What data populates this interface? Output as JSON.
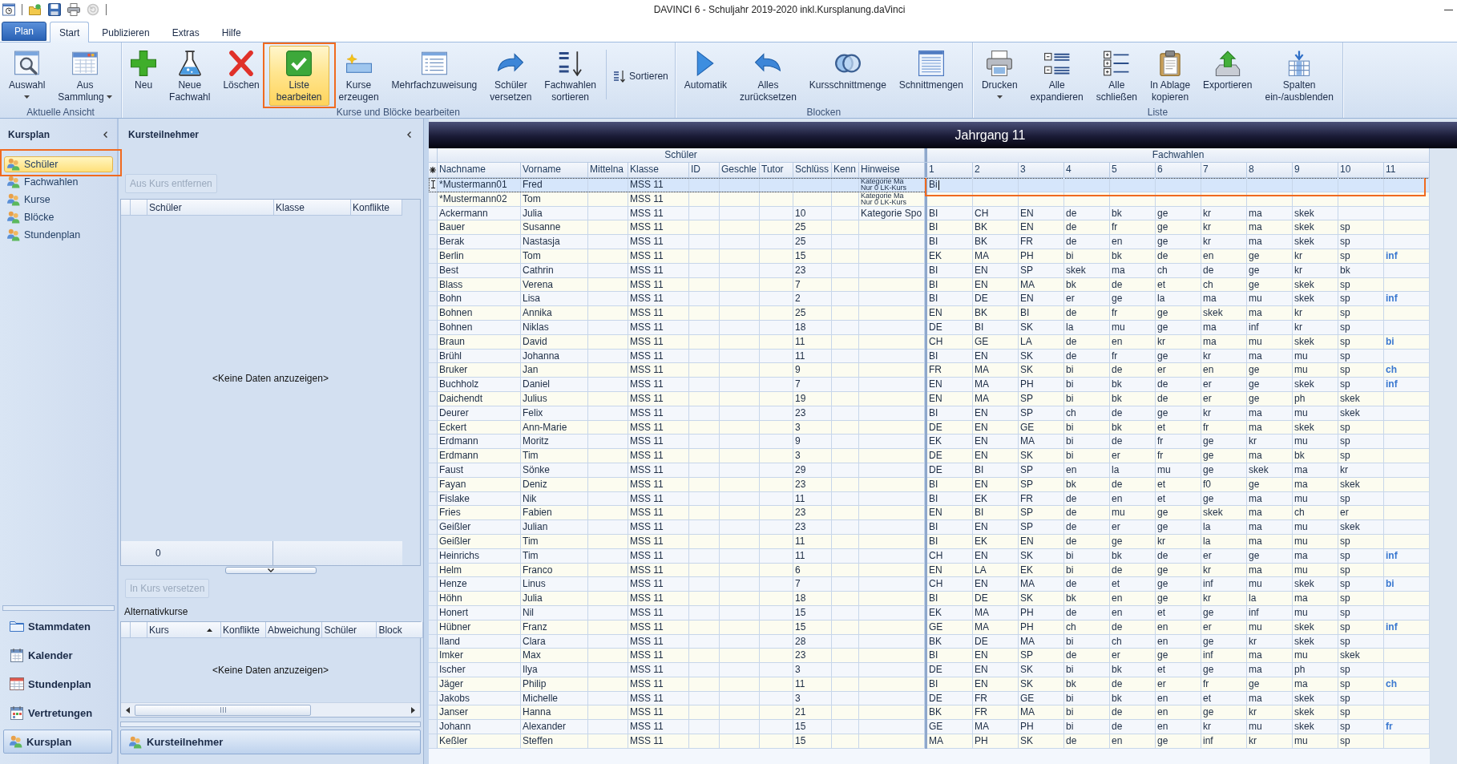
{
  "window": {
    "title": "DAVINCI 6 - Schuljahr 2019-2020 inkl.Kursplanung.daVinci"
  },
  "ribbon": {
    "file_tab": "Plan",
    "tabs": [
      {
        "label": "Start",
        "selected": true
      },
      {
        "label": "Publizieren",
        "selected": false
      },
      {
        "label": "Extras",
        "selected": false
      },
      {
        "label": "Hilfe",
        "selected": false
      }
    ],
    "groups": [
      {
        "label": "Aktuelle Ansicht",
        "buttons": [
          {
            "kind": "large",
            "lines": [
              "Auswahl"
            ],
            "dropdown": true,
            "selected": false
          },
          {
            "kind": "large",
            "lines": [
              "Aus",
              "Sammlung"
            ],
            "dropdown": true,
            "selected": false
          }
        ]
      },
      {
        "label": "Kurse und Blöcke bearbeiten",
        "buttons": [
          {
            "kind": "large",
            "lines": [
              "Neu"
            ],
            "dropdown": false,
            "selected": false
          },
          {
            "kind": "large",
            "lines": [
              "Neue",
              "Fachwahl"
            ],
            "dropdown": false,
            "selected": false
          },
          {
            "kind": "large",
            "lines": [
              "Löschen"
            ],
            "dropdown": false,
            "selected": false
          },
          {
            "kind": "large",
            "lines": [
              "Liste",
              "bearbeiten"
            ],
            "dropdown": false,
            "selected": true
          },
          {
            "kind": "large",
            "lines": [
              "Kurse",
              "erzeugen"
            ],
            "dropdown": false,
            "selected": false
          },
          {
            "kind": "large",
            "lines": [
              "Mehrfachzuweisung"
            ],
            "dropdown": false,
            "selected": false
          },
          {
            "kind": "large",
            "lines": [
              "Schüler",
              "versetzen"
            ],
            "dropdown": false,
            "selected": false
          },
          {
            "kind": "large",
            "lines": [
              "Fachwahlen",
              "sortieren"
            ],
            "dropdown": false,
            "selected": false
          },
          {
            "kind": "small",
            "lines": [
              "Sortieren"
            ],
            "dropdown": false,
            "selected": false
          }
        ]
      },
      {
        "label": "Blocken",
        "buttons": [
          {
            "kind": "large",
            "lines": [
              "Automatik"
            ],
            "dropdown": false,
            "selected": false
          },
          {
            "kind": "large",
            "lines": [
              "Alles",
              "zurücksetzen"
            ],
            "dropdown": false,
            "selected": false
          },
          {
            "kind": "large",
            "lines": [
              "Kursschnittmenge"
            ],
            "dropdown": false,
            "selected": false
          },
          {
            "kind": "large",
            "lines": [
              "Schnittmengen"
            ],
            "dropdown": false,
            "selected": false
          }
        ]
      },
      {
        "label": "Liste",
        "buttons": [
          {
            "kind": "large",
            "lines": [
              "Drucken"
            ],
            "dropdown": true,
            "selected": false
          },
          {
            "kind": "large",
            "lines": [
              "Alle",
              "expandieren"
            ],
            "dropdown": false,
            "selected": false
          },
          {
            "kind": "large",
            "lines": [
              "Alle",
              "schließen"
            ],
            "dropdown": false,
            "selected": false
          },
          {
            "kind": "large",
            "lines": [
              "In Ablage",
              "kopieren"
            ],
            "dropdown": false,
            "selected": false
          },
          {
            "kind": "large",
            "lines": [
              "Exportieren"
            ],
            "dropdown": false,
            "selected": false
          },
          {
            "kind": "large",
            "lines": [
              "Spalten",
              "ein-/ausblenden"
            ],
            "dropdown": false,
            "selected": false
          }
        ]
      }
    ]
  },
  "sidebar": {
    "title": "Kursplan",
    "items": [
      {
        "label": "Schüler",
        "selected": true
      },
      {
        "label": "Fachwahlen",
        "selected": false
      },
      {
        "label": "Kurse",
        "selected": false
      },
      {
        "label": "Blöcke",
        "selected": false
      },
      {
        "label": "Stundenplan",
        "selected": false
      }
    ],
    "sections": [
      {
        "label": "Stammdaten",
        "selected": false
      },
      {
        "label": "Kalender",
        "selected": false
      },
      {
        "label": "Stundenplan",
        "selected": false
      },
      {
        "label": "Vertretungen",
        "selected": false
      },
      {
        "label": "Kursplan",
        "selected": true
      }
    ]
  },
  "course_participants": {
    "title": "Kursteilnehmer",
    "remove_button": {
      "label": "Aus Kurs entfernen",
      "disabled": true
    },
    "table": {
      "columns": [
        "Schüler",
        "Klasse",
        "Konflikte"
      ],
      "empty_text": "<Keine Daten anzuzeigen>",
      "count": "0"
    },
    "move_button": {
      "label": "In Kurs versetzen",
      "disabled": true
    },
    "alternatives": {
      "title": "Alternativkurse",
      "columns": [
        {
          "label": "Kurs",
          "sorted": true
        },
        {
          "label": "Konflikte",
          "sorted": false
        },
        {
          "label": "Abweichung",
          "sorted": false
        },
        {
          "label": "Schüler",
          "sorted": false
        },
        {
          "label": "Block",
          "sorted": false
        }
      ],
      "empty_text": "<Keine Daten anzuzeigen>"
    },
    "footer_tab": "Kursteilnehmer"
  },
  "grid": {
    "title": "Jahrgang 11",
    "groups": [
      "Schüler",
      "Fachwahlen"
    ],
    "columns": [
      "Nachname",
      "Vorname",
      "Mittelna",
      "Klasse",
      "ID",
      "Geschle",
      "Tutor",
      "Schlüss",
      "Kenn",
      "Hinweise"
    ],
    "choice_columns": [
      "1",
      "2",
      "3",
      "4",
      "5",
      "6",
      "7",
      "8",
      "9",
      "10",
      "11"
    ],
    "rows": [
      {
        "nachname": "*Mustermann01",
        "vorname": "Fred",
        "klasse": "MSS 11",
        "hinweise": [
          "Kategorie Ma",
          "Nur 0 LK-Kurs"
        ],
        "fachwahlen": [
          "Bi"
        ],
        "selected": true
      },
      {
        "nachname": "*Mustermann02",
        "vorname": "Tom",
        "klasse": "MSS 11",
        "hinweise": [
          "Kategorie Ma",
          "Nur 0 LK-Kurs"
        ],
        "fachwahlen": [],
        "selected": false
      },
      {
        "nachname": "Ackermann",
        "vorname": "Julia",
        "klasse": "MSS 11",
        "schluessel": "10",
        "hinweise": [
          "Kategorie Spo"
        ],
        "fachwahlen": [
          "BI",
          "CH",
          "EN",
          "de",
          "bk",
          "ge",
          "kr",
          "ma",
          "skek"
        ],
        "selected": false
      },
      {
        "nachname": "Bauer",
        "vorname": "Susanne",
        "klasse": "MSS 11",
        "schluessel": "25",
        "fachwahlen": [
          "BI",
          "BK",
          "EN",
          "de",
          "fr",
          "ge",
          "kr",
          "ma",
          "skek",
          "sp"
        ],
        "selected": false
      },
      {
        "nachname": "Berak",
        "vorname": "Nastasja",
        "klasse": "MSS 11",
        "schluessel": "25",
        "fachwahlen": [
          "BI",
          "BK",
          "FR",
          "de",
          "en",
          "ge",
          "kr",
          "ma",
          "skek",
          "sp"
        ],
        "selected": false
      },
      {
        "nachname": "Berlin",
        "vorname": "Tom",
        "klasse": "MSS 11",
        "schluessel": "15",
        "fachwahlen": [
          "EK",
          "MA",
          "PH",
          "bi",
          "bk",
          "de",
          "en",
          "ge",
          "kr",
          "sp",
          "inf"
        ],
        "selected": false
      },
      {
        "nachname": "Best",
        "vorname": "Cathrin",
        "klasse": "MSS 11",
        "schluessel": "23",
        "fachwahlen": [
          "BI",
          "EN",
          "SP",
          "skek",
          "ma",
          "ch",
          "de",
          "ge",
          "kr",
          "bk"
        ],
        "selected": false
      },
      {
        "nachname": "Blass",
        "vorname": "Verena",
        "klasse": "MSS 11",
        "schluessel": "7",
        "fachwahlen": [
          "BI",
          "EN",
          "MA",
          "bk",
          "de",
          "et",
          "ch",
          "ge",
          "skek",
          "sp"
        ],
        "selected": false
      },
      {
        "nachname": "Bohn",
        "vorname": "Lisa",
        "klasse": "MSS 11",
        "schluessel": "2",
        "fachwahlen": [
          "BI",
          "DE",
          "EN",
          "er",
          "ge",
          "la",
          "ma",
          "mu",
          "skek",
          "sp",
          "inf"
        ],
        "selected": false
      },
      {
        "nachname": "Bohnen",
        "vorname": "Annika",
        "klasse": "MSS 11",
        "schluessel": "25",
        "fachwahlen": [
          "EN",
          "BK",
          "BI",
          "de",
          "fr",
          "ge",
          "skek",
          "ma",
          "kr",
          "sp"
        ],
        "selected": false
      },
      {
        "nachname": "Bohnen",
        "vorname": "Niklas",
        "klasse": "MSS 11",
        "schluessel": "18",
        "fachwahlen": [
          "DE",
          "BI",
          "SK",
          "la",
          "mu",
          "ge",
          "ma",
          "inf",
          "kr",
          "sp"
        ],
        "selected": false
      },
      {
        "nachname": "Braun",
        "vorname": "David",
        "klasse": "MSS 11",
        "schluessel": "11",
        "fachwahlen": [
          "CH",
          "GE",
          "LA",
          "de",
          "en",
          "kr",
          "ma",
          "mu",
          "skek",
          "sp",
          "bi"
        ],
        "selected": false
      },
      {
        "nachname": "Brühl",
        "vorname": "Johanna",
        "klasse": "MSS 11",
        "schluessel": "11",
        "fachwahlen": [
          "BI",
          "EN",
          "SK",
          "de",
          "fr",
          "ge",
          "kr",
          "ma",
          "mu",
          "sp"
        ],
        "selected": false
      },
      {
        "nachname": "Bruker",
        "vorname": "Jan",
        "klasse": "MSS 11",
        "schluessel": "9",
        "fachwahlen": [
          "FR",
          "MA",
          "SK",
          "bi",
          "de",
          "er",
          "en",
          "ge",
          "mu",
          "sp",
          "ch"
        ],
        "selected": false
      },
      {
        "nachname": "Buchholz",
        "vorname": "Daniel",
        "klasse": "MSS 11",
        "schluessel": "7",
        "fachwahlen": [
          "EN",
          "MA",
          "PH",
          "bi",
          "bk",
          "de",
          "er",
          "ge",
          "skek",
          "sp",
          "inf"
        ],
        "selected": false
      },
      {
        "nachname": "Daichendt",
        "vorname": "Julius",
        "klasse": "MSS 11",
        "schluessel": "19",
        "fachwahlen": [
          "EN",
          "MA",
          "SP",
          "bi",
          "bk",
          "de",
          "er",
          "ge",
          "ph",
          "skek"
        ],
        "selected": false
      },
      {
        "nachname": "Deurer",
        "vorname": "Felix",
        "klasse": "MSS 11",
        "schluessel": "23",
        "fachwahlen": [
          "BI",
          "EN",
          "SP",
          "ch",
          "de",
          "ge",
          "kr",
          "ma",
          "mu",
          "skek"
        ],
        "selected": false
      },
      {
        "nachname": "Eckert",
        "vorname": "Ann-Marie",
        "klasse": "MSS 11",
        "schluessel": "3",
        "fachwahlen": [
          "DE",
          "EN",
          "GE",
          "bi",
          "bk",
          "et",
          "fr",
          "ma",
          "skek",
          "sp"
        ],
        "selected": false
      },
      {
        "nachname": "Erdmann",
        "vorname": "Moritz",
        "klasse": "MSS 11",
        "schluessel": "9",
        "fachwahlen": [
          "EK",
          "EN",
          "MA",
          "bi",
          "de",
          "fr",
          "ge",
          "kr",
          "mu",
          "sp"
        ],
        "selected": false
      },
      {
        "nachname": "Erdmann",
        "vorname": "Tim",
        "klasse": "MSS 11",
        "schluessel": "3",
        "fachwahlen": [
          "DE",
          "EN",
          "SK",
          "bi",
          "er",
          "fr",
          "ge",
          "ma",
          "bk",
          "sp"
        ],
        "selected": false
      },
      {
        "nachname": "Faust",
        "vorname": "Sönke",
        "klasse": "MSS 11",
        "schluessel": "29",
        "fachwahlen": [
          "DE",
          "BI",
          "SP",
          "en",
          "la",
          "mu",
          "ge",
          "skek",
          "ma",
          "kr"
        ],
        "selected": false
      },
      {
        "nachname": "Fayan",
        "vorname": "Deniz",
        "klasse": "MSS 11",
        "schluessel": "23",
        "fachwahlen": [
          "BI",
          "EN",
          "SP",
          "bk",
          "de",
          "et",
          "f0",
          "ge",
          "ma",
          "skek"
        ],
        "selected": false
      },
      {
        "nachname": "Fislake",
        "vorname": "Nik",
        "klasse": "MSS 11",
        "schluessel": "11",
        "fachwahlen": [
          "BI",
          "EK",
          "FR",
          "de",
          "en",
          "et",
          "ge",
          "ma",
          "mu",
          "sp"
        ],
        "selected": false
      },
      {
        "nachname": "Fries",
        "vorname": "Fabien",
        "klasse": "MSS 11",
        "schluessel": "23",
        "fachwahlen": [
          "EN",
          "BI",
          "SP",
          "de",
          "mu",
          "ge",
          "skek",
          "ma",
          "ch",
          "er"
        ],
        "selected": false
      },
      {
        "nachname": "Geißler",
        "vorname": "Julian",
        "klasse": "MSS 11",
        "schluessel": "23",
        "fachwahlen": [
          "BI",
          "EN",
          "SP",
          "de",
          "er",
          "ge",
          "la",
          "ma",
          "mu",
          "skek"
        ],
        "selected": false
      },
      {
        "nachname": "Geißler",
        "vorname": "Tim",
        "klasse": "MSS 11",
        "schluessel": "11",
        "fachwahlen": [
          "BI",
          "EK",
          "EN",
          "de",
          "ge",
          "kr",
          "la",
          "ma",
          "mu",
          "sp"
        ],
        "selected": false
      },
      {
        "nachname": "Heinrichs",
        "vorname": "Tim",
        "klasse": "MSS 11",
        "schluessel": "11",
        "fachwahlen": [
          "CH",
          "EN",
          "SK",
          "bi",
          "bk",
          "de",
          "er",
          "ge",
          "ma",
          "sp",
          "inf"
        ],
        "selected": false
      },
      {
        "nachname": "Helm",
        "vorname": "Franco",
        "klasse": "MSS 11",
        "schluessel": "6",
        "fachwahlen": [
          "EN",
          "LA",
          "EK",
          "bi",
          "de",
          "ge",
          "kr",
          "ma",
          "mu",
          "sp"
        ],
        "selected": false
      },
      {
        "nachname": "Henze",
        "vorname": "Linus",
        "klasse": "MSS 11",
        "schluessel": "7",
        "fachwahlen": [
          "CH",
          "EN",
          "MA",
          "de",
          "et",
          "ge",
          "inf",
          "mu",
          "skek",
          "sp",
          "bi"
        ],
        "selected": false
      },
      {
        "nachname": "Höhn",
        "vorname": "Julia",
        "klasse": "MSS 11",
        "schluessel": "18",
        "fachwahlen": [
          "BI",
          "DE",
          "SK",
          "bk",
          "en",
          "ge",
          "kr",
          "la",
          "ma",
          "sp"
        ],
        "selected": false
      },
      {
        "nachname": "Honert",
        "vorname": "Nil",
        "klasse": "MSS 11",
        "schluessel": "15",
        "fachwahlen": [
          "EK",
          "MA",
          "PH",
          "de",
          "en",
          "et",
          "ge",
          "inf",
          "mu",
          "sp"
        ],
        "selected": false
      },
      {
        "nachname": "Hübner",
        "vorname": "Franz",
        "klasse": "MSS 11",
        "schluessel": "15",
        "fachwahlen": [
          "GE",
          "MA",
          "PH",
          "ch",
          "de",
          "en",
          "er",
          "mu",
          "skek",
          "sp",
          "inf"
        ],
        "selected": false
      },
      {
        "nachname": "Iland",
        "vorname": "Clara",
        "klasse": "MSS 11",
        "schluessel": "28",
        "fachwahlen": [
          "BK",
          "DE",
          "MA",
          "bi",
          "ch",
          "en",
          "ge",
          "kr",
          "skek",
          "sp"
        ],
        "selected": false
      },
      {
        "nachname": "Imker",
        "vorname": "Max",
        "klasse": "MSS 11",
        "schluessel": "23",
        "fachwahlen": [
          "BI",
          "EN",
          "SP",
          "de",
          "er",
          "ge",
          "inf",
          "ma",
          "mu",
          "skek"
        ],
        "selected": false
      },
      {
        "nachname": "Ischer",
        "vorname": "Ilya",
        "klasse": "MSS 11",
        "schluessel": "3",
        "fachwahlen": [
          "DE",
          "EN",
          "SK",
          "bi",
          "bk",
          "et",
          "ge",
          "ma",
          "ph",
          "sp"
        ],
        "selected": false
      },
      {
        "nachname": "Jäger",
        "vorname": "Philip",
        "klasse": "MSS 11",
        "schluessel": "11",
        "fachwahlen": [
          "BI",
          "EN",
          "SK",
          "bk",
          "de",
          "er",
          "fr",
          "ge",
          "ma",
          "sp",
          "ch"
        ],
        "selected": false
      },
      {
        "nachname": "Jakobs",
        "vorname": "Michelle",
        "klasse": "MSS 11",
        "schluessel": "3",
        "fachwahlen": [
          "DE",
          "FR",
          "GE",
          "bi",
          "bk",
          "en",
          "et",
          "ma",
          "skek",
          "sp"
        ],
        "selected": false
      },
      {
        "nachname": "Janser",
        "vorname": "Hanna",
        "klasse": "MSS 11",
        "schluessel": "21",
        "fachwahlen": [
          "BK",
          "FR",
          "MA",
          "bi",
          "de",
          "en",
          "ge",
          "kr",
          "skek",
          "sp"
        ],
        "selected": false
      },
      {
        "nachname": "Johann",
        "vorname": "Alexander",
        "klasse": "MSS 11",
        "schluessel": "15",
        "fachwahlen": [
          "GE",
          "MA",
          "PH",
          "bi",
          "de",
          "en",
          "kr",
          "mu",
          "skek",
          "sp",
          "fr"
        ],
        "selected": false
      },
      {
        "nachname": "Keßler",
        "vorname": "Steffen",
        "klasse": "MSS 11",
        "schluessel": "15",
        "fachwahlen": [
          "MA",
          "PH",
          "SK",
          "de",
          "en",
          "ge",
          "inf",
          "kr",
          "mu",
          "sp"
        ],
        "selected": false
      }
    ]
  }
}
